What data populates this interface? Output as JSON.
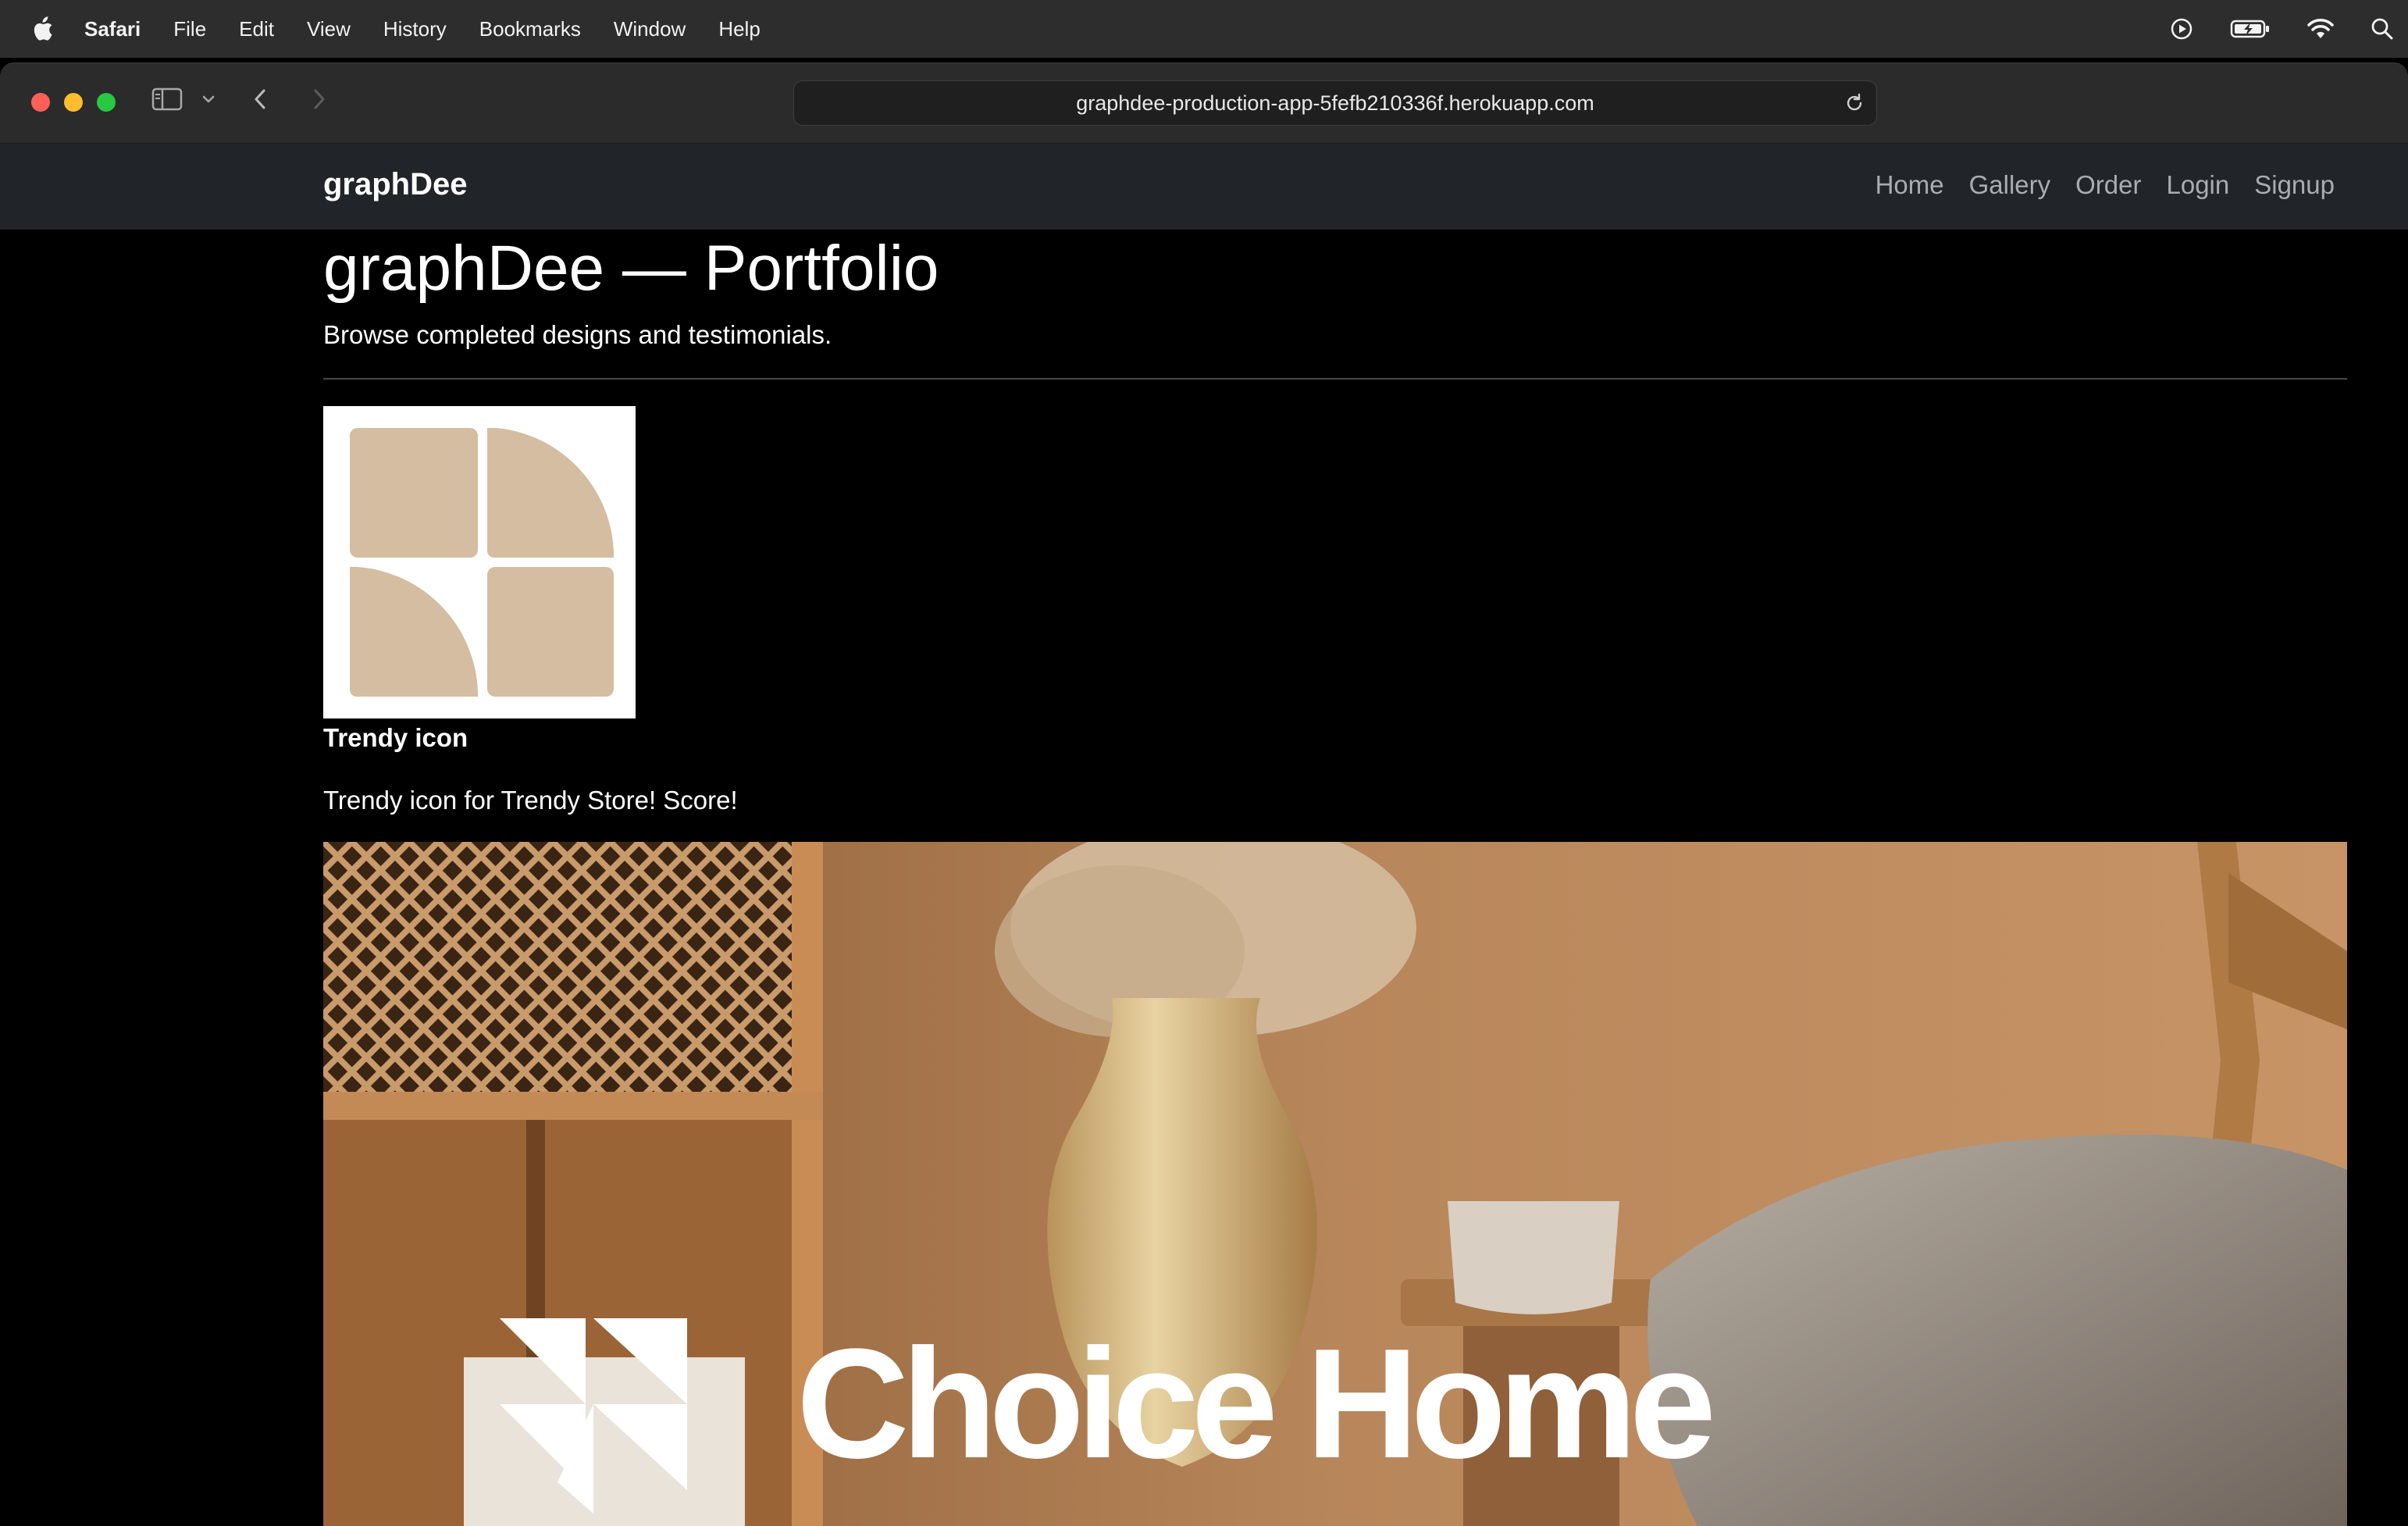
{
  "menubar": {
    "app": "Safari",
    "items": [
      "File",
      "Edit",
      "View",
      "History",
      "Bookmarks",
      "Window",
      "Help"
    ],
    "status_icons": [
      "play-circle-icon",
      "battery-charging-icon",
      "wifi-icon",
      "search-icon"
    ]
  },
  "browser": {
    "url": "graphdee-production-app-5fefb210336f.herokuapp.com"
  },
  "navbar": {
    "brand": "graphDee",
    "links": [
      "Home",
      "Gallery",
      "Order",
      "Login",
      "Signup"
    ]
  },
  "page": {
    "title": "graphDee — Portfolio",
    "lead": "Browse completed designs and testimonials.",
    "items": [
      {
        "title": "Trendy icon",
        "description": "Trendy icon for Trendy Store! Score!"
      },
      {
        "logo_text": "Choice Home"
      }
    ]
  },
  "colors": {
    "menubar_bg": "#2d2d2d",
    "toolbar_bg": "#2b2b2b",
    "navbar_bg": "#212529",
    "nav_link": "#a9adb1",
    "page_bg": "#000000",
    "icon_tan": "#d4bda0",
    "close": "#ff5f57",
    "minimize": "#febc2e",
    "zoom": "#28c840"
  }
}
